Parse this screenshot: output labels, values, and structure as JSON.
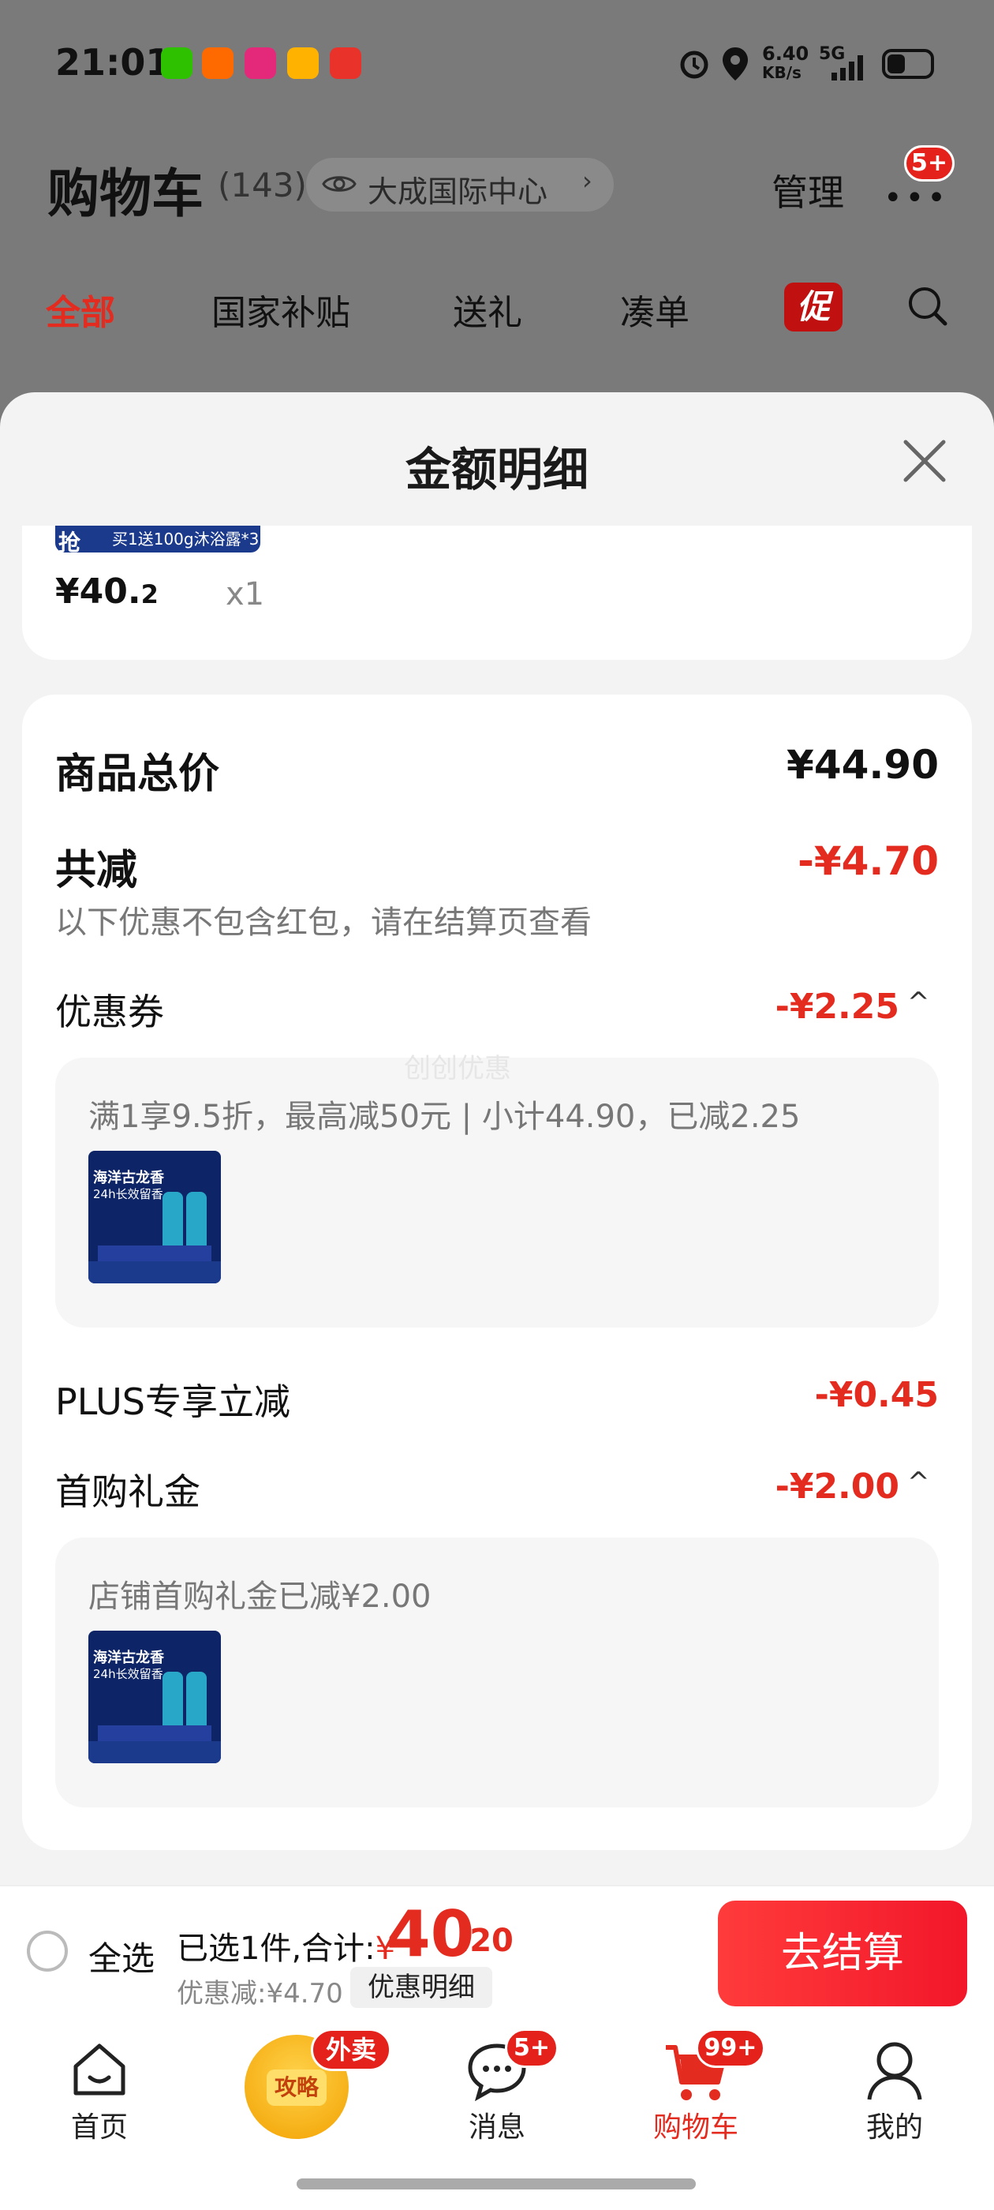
{
  "status_bar": {
    "time": "21:01",
    "network_speed_top": "6.40",
    "network_speed_unit": "KB/s",
    "network_type": "5G"
  },
  "header": {
    "title": "购物车",
    "count": "(143)",
    "location": "大成国际中心",
    "manage": "管理",
    "more_badge": "5+"
  },
  "tabs": [
    "全部",
    "国家补贴",
    "送礼",
    "凑单"
  ],
  "promo_tab_glyph": "促",
  "sheet": {
    "title": "金额明细",
    "item_price_main": "¥40.",
    "item_price_decimal": "2",
    "item_qty": "x1",
    "thumb_banner": "买1送100g沐浴露*3",
    "thumb_flash": "抢",
    "total_label": "商品总价",
    "total_value": "¥44.90",
    "discount_label": "共减",
    "discount_value": "-¥4.70",
    "discount_note": "以下优惠不包含红包，请在结算页查看",
    "coupon_label": "优惠券",
    "coupon_value": "-¥2.25",
    "coupon_detail": "满1享9.5折，最高减50元 | 小计44.90，已减2.25",
    "watermark": "创创优惠",
    "plus_label": "PLUS专享立减",
    "plus_value": "-¥0.45",
    "gift_label": "首购礼金",
    "gift_value": "-¥2.00",
    "gift_detail": "店铺首购礼金已减¥2.00",
    "product_thumb_text": "海洋古龙香",
    "product_thumb_sub": "24h长效留香"
  },
  "checkout": {
    "select_all": "全选",
    "selected_text": "已选1件,合计:",
    "yen": "¥",
    "amount_int": "40",
    "amount_dec": ".20",
    "saved": "优惠减:¥4.70",
    "detail_button": "优惠明细",
    "pay_button": "去结算"
  },
  "bottom_nav": {
    "items": [
      {
        "label": "首页",
        "icon": "home-icon"
      },
      {
        "label": "攻略",
        "icon": "guide-icon",
        "badge": "外卖"
      },
      {
        "label": "消息",
        "icon": "message-icon",
        "badge": "5+"
      },
      {
        "label": "购物车",
        "icon": "cart-icon",
        "badge": "99+"
      },
      {
        "label": "我的",
        "icon": "profile-icon"
      }
    ]
  },
  "colors": {
    "accent": "#e42b1f",
    "pay_gradient_start": "#ff3b3b",
    "pay_gradient_end": "#f2172a"
  }
}
